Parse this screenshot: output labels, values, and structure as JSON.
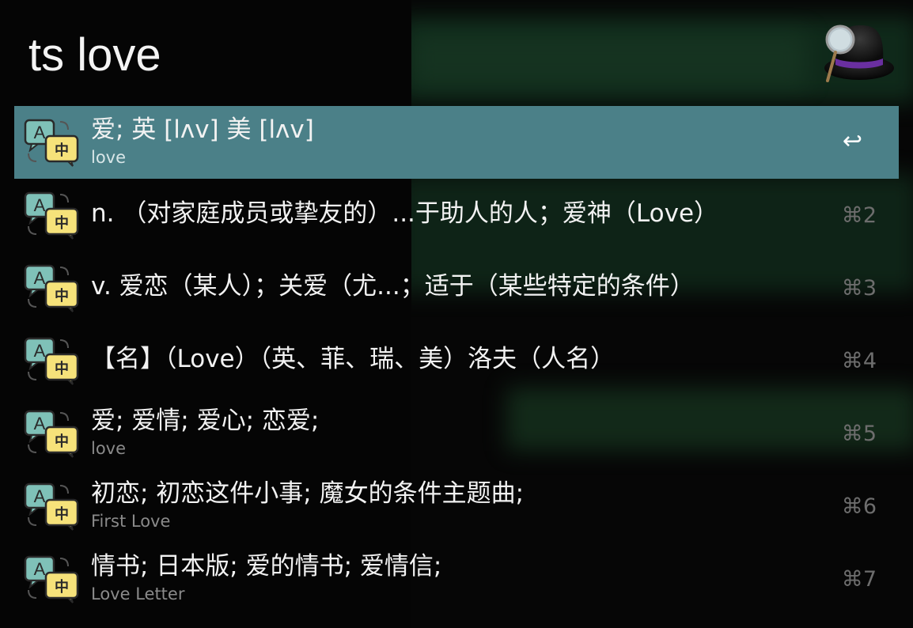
{
  "search": {
    "query": "ts love"
  },
  "results": [
    {
      "title": "爱;  英 [lʌv] 美 [lʌv]",
      "subtitle": "love",
      "shortcut": "↩",
      "selected": true
    },
    {
      "title": "n. （对家庭成员或挚友的）...于助人的人；爱神（Love）",
      "subtitle": "",
      "shortcut": "⌘2",
      "selected": false
    },
    {
      "title": "v. 爱恋（某人）；关爱（尤...；适于（某些特定的条件）",
      "subtitle": "",
      "shortcut": "⌘3",
      "selected": false
    },
    {
      "title": "【名】（Love）（英、菲、瑞、美）洛夫（人名）",
      "subtitle": "",
      "shortcut": "⌘4",
      "selected": false
    },
    {
      "title": "爱; 爱情; 爱心; 恋爱;",
      "subtitle": "love",
      "shortcut": "⌘5",
      "selected": false
    },
    {
      "title": "初恋; 初恋这件小事; 魔女的条件主题曲;",
      "subtitle": "First Love",
      "shortcut": "⌘6",
      "selected": false
    },
    {
      "title": "情书; 日本版; 爱的情书; 爱情信;",
      "subtitle": "Love Letter",
      "shortcut": "⌘7",
      "selected": false
    }
  ],
  "icons": {
    "app": "alfred-hat-icon",
    "result": "translate-icon"
  },
  "colors": {
    "selected_row": "#4b8088",
    "background": "#060606",
    "title_text": "#f2f2f2",
    "subtitle_text": "#8a8a8a",
    "shortcut_text": "#6d6d6d"
  }
}
